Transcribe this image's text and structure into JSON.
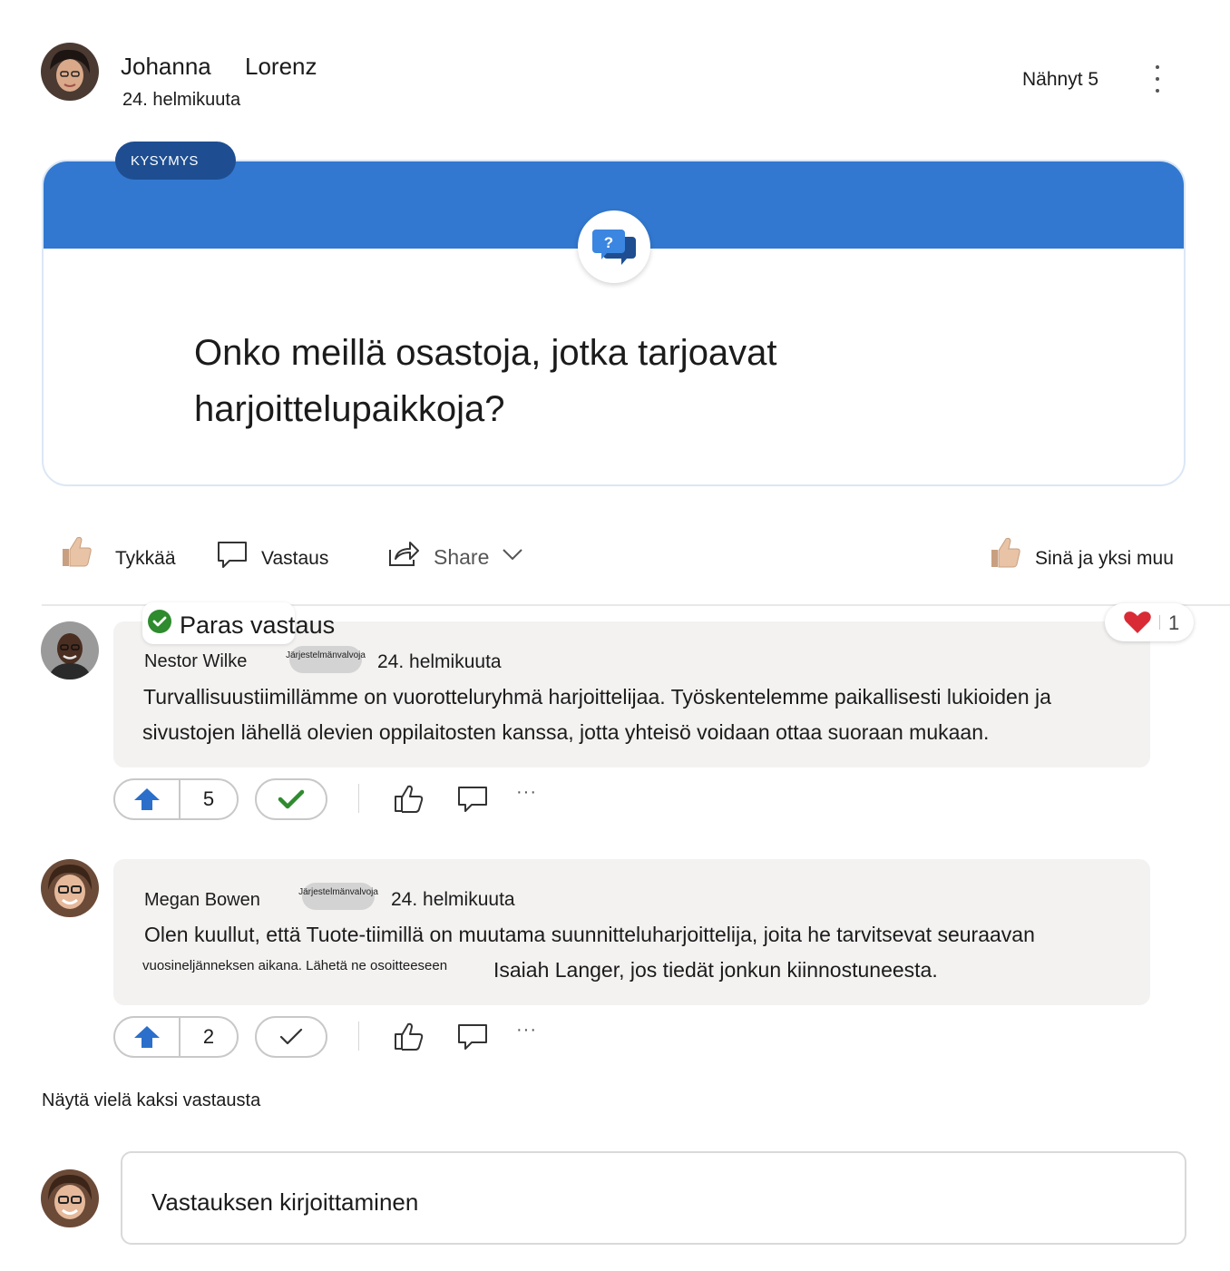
{
  "post": {
    "author_first": "Johanna",
    "author_last": "Lorenz",
    "date": "24. helmikuuta",
    "seen": "Nähnyt 5",
    "tag": "KYSYMYS",
    "question": "Onko meillä osastoja, jotka tarjoavat harjoittelupaikkoja?"
  },
  "actions": {
    "like": "Tykkää",
    "reply": "Vastaus",
    "share": "Share",
    "liked_by": "Sinä ja yksi muu"
  },
  "answers": [
    {
      "best_label": "Paras vastaus",
      "heart_count": "1",
      "name": "Nestor Wilke",
      "role": "Järjestelmänvalvoja",
      "date": "24. helmikuuta",
      "line1": "Turvallisuustiimillämme on vuorotteluryhmä harjoittelijaa. Työskentelemme paikallisesti lukioiden ja",
      "line2": "sivustojen lähellä olevien oppilaitosten kanssa, jotta yhteisö voidaan ottaa suoraan mukaan.",
      "votes": "5"
    },
    {
      "name": "Megan Bowen",
      "role": "Järjestelmänvalvoja",
      "date": "24. helmikuuta",
      "line1": "Olen kuullut, että Tuote-tiimillä on muutama suunnitteluharjoittelija, joita he tarvitsevat seuraavan",
      "line2a": "vuosineljänneksen aikana. Lähetä ne osoitteeseen",
      "line2b": "Isaiah Langer, jos tiedät jonkun kiinnostuneesta.",
      "votes": "2"
    }
  ],
  "show_more": "Näytä vielä kaksi vastausta",
  "reply_placeholder": "Vastauksen kirjoittaminen",
  "colors": {
    "accent": "#3278d0",
    "tag_bg": "#1e4e91",
    "answer_bg": "#f3f2f1",
    "vote_blue": "#2b6fcb",
    "check_green": "#2e8b2e",
    "heart": "#d92b35"
  },
  "icons": [
    "avatar",
    "more-vertical-icon",
    "question-chat-icon",
    "thumbs-up-icon",
    "comment-icon",
    "share-icon",
    "chevron-down-icon",
    "check-circle-icon",
    "heart-icon",
    "upvote-arrow-icon",
    "checkmark-icon",
    "like-outline-icon",
    "more-horizontal-icon"
  ]
}
